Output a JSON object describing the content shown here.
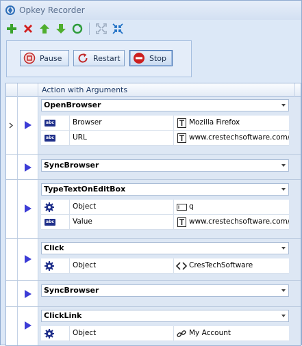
{
  "window": {
    "title": "Opkey Recorder"
  },
  "toolbar": {
    "icons": [
      "add-icon",
      "delete-icon",
      "move-up-icon",
      "move-down-icon",
      "refresh-icon",
      "expand-icon",
      "collapse-icon"
    ]
  },
  "controls": {
    "pause": "Pause",
    "restart": "Restart",
    "stop": "Stop"
  },
  "grid": {
    "header": "Action with Arguments",
    "rows": [
      {
        "action": "OpenBrowser",
        "args": [
          {
            "type": "text",
            "name": "Browser",
            "value_icon": "text-icon",
            "value": "Mozilla Firefox"
          },
          {
            "type": "text",
            "name": "URL",
            "value_icon": "text-icon",
            "value": "www.crestechsoftware.com/C"
          }
        ]
      },
      {
        "action": "SyncBrowser",
        "args": []
      },
      {
        "action": "TypeTextOnEditBox",
        "args": [
          {
            "type": "object",
            "name": "Object",
            "value_icon": "editbox-icon",
            "value": "q"
          },
          {
            "type": "text",
            "name": "Value",
            "value_icon": "text-icon",
            "value": "www.crestechsoftware.com/C"
          }
        ]
      },
      {
        "action": "Click",
        "args": [
          {
            "type": "object",
            "name": "Object",
            "value_icon": "element-icon",
            "value": "CresTechSoftware"
          }
        ]
      },
      {
        "action": "SyncBrowser",
        "args": []
      },
      {
        "action": "ClickLink",
        "args": [
          {
            "type": "object",
            "name": "Object",
            "value_icon": "link-icon",
            "value": "My Account"
          }
        ]
      }
    ]
  },
  "colors": {
    "accent": "#4040d8",
    "stop": "#cc1f1f",
    "panel": "#dce8f7"
  }
}
